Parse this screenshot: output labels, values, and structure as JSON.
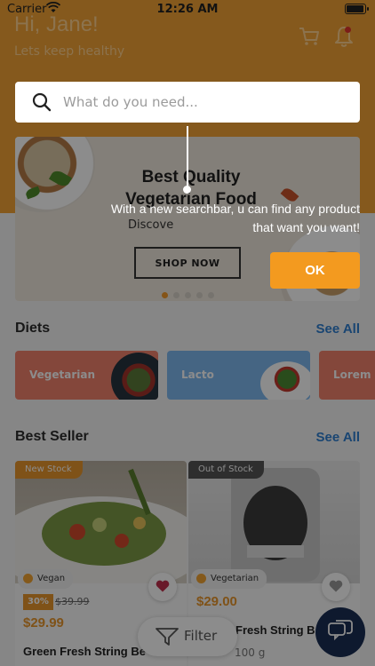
{
  "status_bar": {
    "carrier": "Carrier",
    "time": "12:26 AM",
    "battery_level": 0.9
  },
  "header": {
    "greeting": "Hi, Jane!",
    "subtitle": "Lets keep healthy"
  },
  "search": {
    "placeholder": "What do you need..."
  },
  "banner": {
    "title": "Best Quality Vegetarian Food",
    "subtitle": "Discove",
    "cta_label": "SHOP NOW",
    "active_slide": 1,
    "slide_count": 5
  },
  "diets": {
    "title": "Diets",
    "see_all": "See All",
    "items": [
      {
        "label": "Vegetarian"
      },
      {
        "label": "Lacto"
      },
      {
        "label": "Lorem Ip"
      }
    ]
  },
  "best_seller": {
    "title": "Best Seller",
    "see_all": "See All",
    "products": [
      {
        "tag": "New Stock",
        "category": "Vegan",
        "discount": "30%",
        "old_price": "$39.99",
        "price": "$29.99",
        "name": "Green Fresh String Be",
        "favorited": true
      },
      {
        "tag": "Out of Stock",
        "category": "Vegetarian",
        "price": "$29.00",
        "name": "Fresh String B",
        "weight": "100 g",
        "favorited": false
      }
    ]
  },
  "filter": {
    "label": "Filter"
  },
  "tooltip": {
    "text": "With a new searchbar, u can find any product that want you want!",
    "ok_label": "OK"
  },
  "colors": {
    "brand_orange": "#f3a235",
    "accent_orange": "#e8962c",
    "link_blue": "#2f7fd0",
    "chat_navy": "#1a2f55"
  }
}
